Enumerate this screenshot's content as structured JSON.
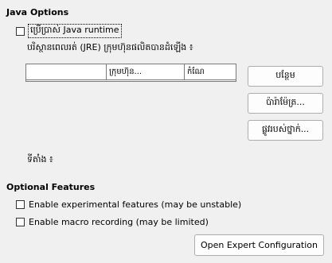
{
  "java_options": {
    "section_title": "Java Options",
    "use_runtime_label": "ប្រើប្រាស់ Java runtime",
    "installed_jre_text": "បរិស្ថានពេលរត់ (JRE) ក្រុមហ៊ុនផលិតបានដំឡើង ៖",
    "table": {
      "columns": [
        "",
        "ក្រុមហ៊ុន...",
        "កំណែ"
      ]
    },
    "add_button": "បន្ថែម",
    "parameters_button": "ប៉ារ៉ាម៉ែត្រ...",
    "class_path_button": "ផ្លូវរបស់ថ្នាក់...",
    "location_label": "ទីតាំង ៖"
  },
  "optional_features": {
    "section_title": "Optional Features",
    "experimental_label": "Enable experimental features (may be unstable)",
    "macro_recording_label": "Enable macro recording (may be limited)",
    "expert_config_button": "Open Expert Configuration"
  }
}
